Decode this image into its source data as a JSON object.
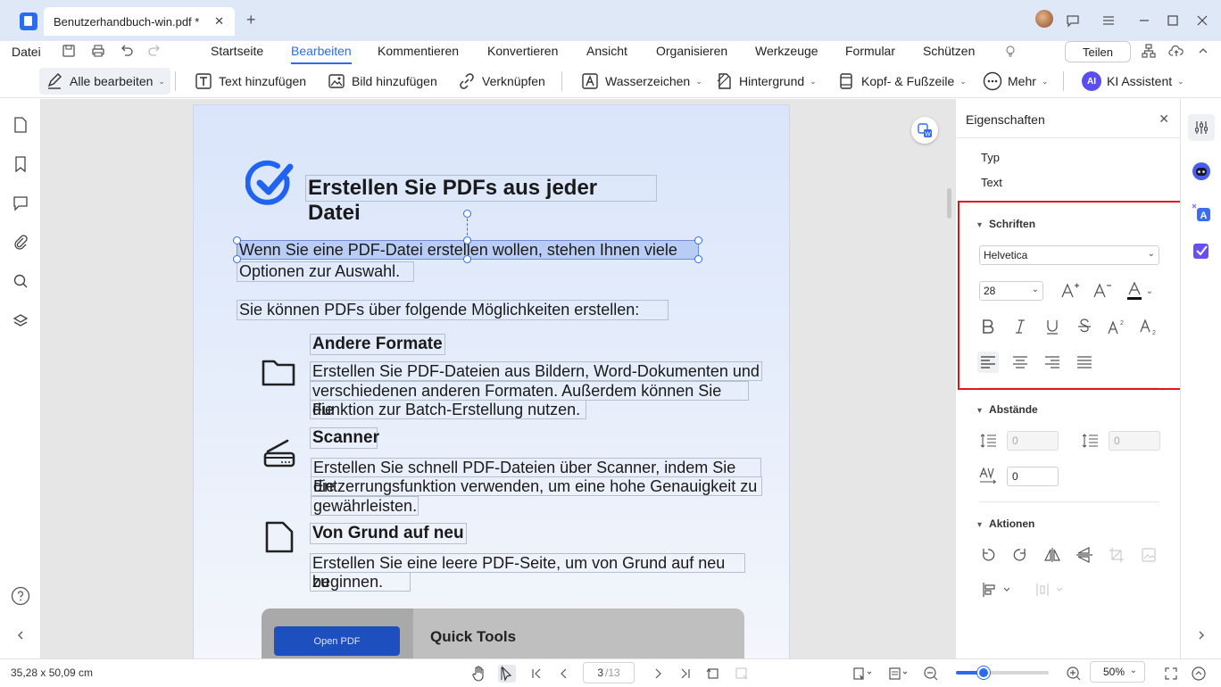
{
  "titlebar": {
    "doc_tab_title": "Benutzerhandbuch-win.pdf *"
  },
  "menubar": {
    "file_label": "Datei",
    "tabs": [
      "Startseite",
      "Bearbeiten",
      "Kommentieren",
      "Konvertieren",
      "Ansicht",
      "Organisieren",
      "Werkzeuge",
      "Formular",
      "Schützen"
    ],
    "active_tab": "Bearbeiten",
    "share_label": "Teilen"
  },
  "toolbar": {
    "edit_all": "Alle bearbeiten",
    "add_text": "Text hinzufügen",
    "add_image": "Bild hinzufügen",
    "link": "Verknüpfen",
    "watermark": "Wasserzeichen",
    "background": "Hintergrund",
    "header_footer": "Kopf- & Fußzeile",
    "more": "Mehr",
    "ai_badge": "AI",
    "ai_assistant": "KI Assistent"
  },
  "document": {
    "heading": "Erstellen Sie PDFs aus jeder Datei",
    "intro_line1": "Wenn Sie eine PDF-Datei erstellen wollen, stehen Ihnen viele",
    "intro_line2": "Optionen zur Auswahl.",
    "options_intro": "Sie können PDFs über folgende Möglichkeiten erstellen:",
    "items": [
      {
        "title": "Andere Formate",
        "icon": "folder-icon",
        "lines": [
          "Erstellen Sie PDF-Dateien aus Bildern, Word-Dokumenten und",
          "verschiedenen anderen Formaten. Außerdem können Sie die",
          "Funktion zur Batch-Erstellung nutzen."
        ]
      },
      {
        "title": "Scanner",
        "icon": "scanner-icon",
        "lines": [
          "Erstellen Sie schnell PDF-Dateien über Scanner, indem Sie die",
          "Entzerrungsfunktion verwenden, um eine hohe Genauigkeit zu",
          "gewährleisten."
        ]
      },
      {
        "title": "Von Grund auf neu",
        "icon": "blank-page-icon",
        "lines": [
          "Erstellen Sie eine leere PDF-Seite, um von Grund auf neu zu",
          "beginnen."
        ]
      }
    ],
    "quick_tools_button": "Open PDF",
    "quick_tools_title": "Quick Tools"
  },
  "panel": {
    "title": "Eigenschaften",
    "type_label": "Typ",
    "type_value": "Text",
    "fonts_section": "Schriften",
    "font_family": "Helvetica",
    "font_size": "28",
    "spacing_section": "Abstände",
    "line_spacing": "0",
    "paragraph_spacing": "0",
    "char_spacing": "0",
    "actions_section": "Aktionen",
    "format_buttons": [
      "bold",
      "italic",
      "underline",
      "strikethrough",
      "superscript",
      "subscript"
    ],
    "align_buttons": [
      "align-left",
      "align-center",
      "align-right",
      "justify"
    ],
    "active_align": "align-left",
    "highlight_color": "#e0161a"
  },
  "statusbar": {
    "coords": "35,28 x 50,09 cm",
    "page_current": "3",
    "page_total": "/13",
    "zoom": "50%",
    "zoom_fraction": 0.3
  },
  "colors": {
    "accent": "#2b6bf0",
    "titlebar_bg": "#dfe8f7"
  }
}
